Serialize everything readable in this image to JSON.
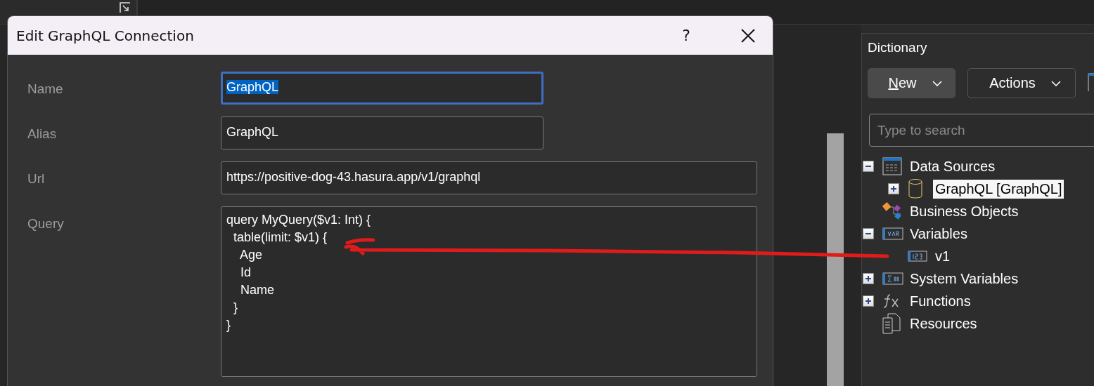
{
  "dialog": {
    "title": "Edit GraphQL Connection",
    "help": "?",
    "fields": [
      {
        "label": "Name",
        "kind": "single",
        "value": "GraphQL",
        "focused": true,
        "text_selected": true,
        "wide": false
      },
      {
        "label": "Alias",
        "kind": "single",
        "value": "GraphQL",
        "focused": false,
        "text_selected": false,
        "wide": false
      },
      {
        "label": "Url",
        "kind": "single",
        "value": "https://positive-dog-43.hasura.app/v1/graphql",
        "focused": false,
        "text_selected": false,
        "wide": true
      },
      {
        "label": "Query",
        "kind": "multiline",
        "value": "query MyQuery($v1: Int) {\n  table(limit: $v1) {\n    Age\n    Id\n    Name\n  }\n}",
        "focused": false,
        "text_selected": false,
        "wide": true
      }
    ]
  },
  "dictionary": {
    "title": "Dictionary",
    "buttons": [
      {
        "label": "New",
        "highlighted": true,
        "underline_first": true
      },
      {
        "label": "Actions",
        "highlighted": false,
        "underline_first": false
      }
    ],
    "search": {
      "placeholder": "Type to search"
    },
    "tree": [
      {
        "label": "Data Sources",
        "kind": "datasources",
        "expanded": true,
        "selected": false,
        "children": [
          {
            "label": "GraphQL [GraphQL]",
            "kind": "database",
            "expanded": false,
            "selected": true
          }
        ]
      },
      {
        "label": "Business Objects",
        "kind": "business",
        "selected": false
      },
      {
        "label": "Variables",
        "kind": "variables",
        "expanded": true,
        "selected": false,
        "children": [
          {
            "label": "v1",
            "kind": "number",
            "selected": false
          }
        ]
      },
      {
        "label": "System Variables",
        "kind": "sysvars",
        "expanded": false,
        "selected": false
      },
      {
        "label": "Functions",
        "kind": "functions",
        "expanded": false,
        "selected": false
      },
      {
        "label": "Resources",
        "kind": "resources",
        "selected": false
      }
    ]
  }
}
